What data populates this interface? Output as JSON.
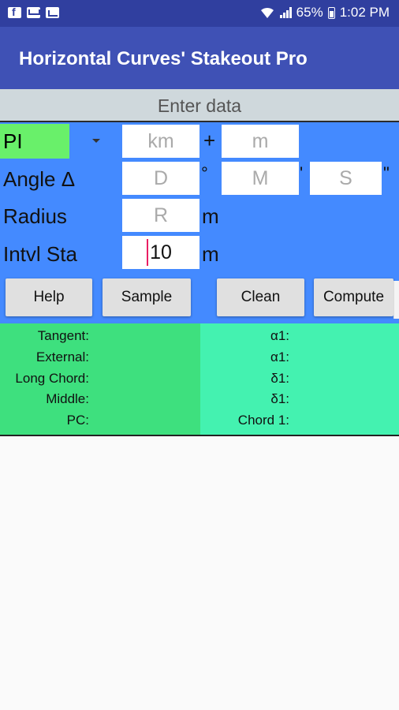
{
  "status_bar": {
    "battery": "65%",
    "time": "1:02 PM",
    "left_icons": [
      "facebook-icon",
      "mail-icon",
      "chart-icon"
    ]
  },
  "app_bar": {
    "title": "Horizontal Curves' Stakeout Pro"
  },
  "form": {
    "header": "Enter data",
    "pi_label": "PI",
    "km_placeholder": "km",
    "plus": "+",
    "m_placeholder": "m",
    "angle_label": "Angle Δ",
    "deg_placeholder": "D",
    "deg_symbol": "°",
    "min_placeholder": "M",
    "min_symbol": "'",
    "sec_placeholder": "S",
    "sec_symbol": "\"",
    "radius_label": "Radius",
    "radius_placeholder": "R",
    "radius_unit": "m",
    "interval_label": "Intvl Sta",
    "interval_value": "10",
    "interval_unit": "m"
  },
  "buttons": {
    "help": "Help",
    "sample": "Sample",
    "clean": "Clean",
    "compute": "Compute"
  },
  "results": {
    "left": [
      "Tangent:",
      "External:",
      "Long Chord:",
      "Middle:",
      "PC:"
    ],
    "right": [
      "α1:",
      "α1:",
      "δ1:",
      "δ1:",
      "Chord 1:"
    ]
  },
  "colors": {
    "status_bar": "#303f9f",
    "app_bar": "#3f51b5",
    "panel": "#448aff",
    "pi_select": "#69f06a",
    "result_left": "#3ee07e",
    "result_right": "#44f2b0"
  }
}
